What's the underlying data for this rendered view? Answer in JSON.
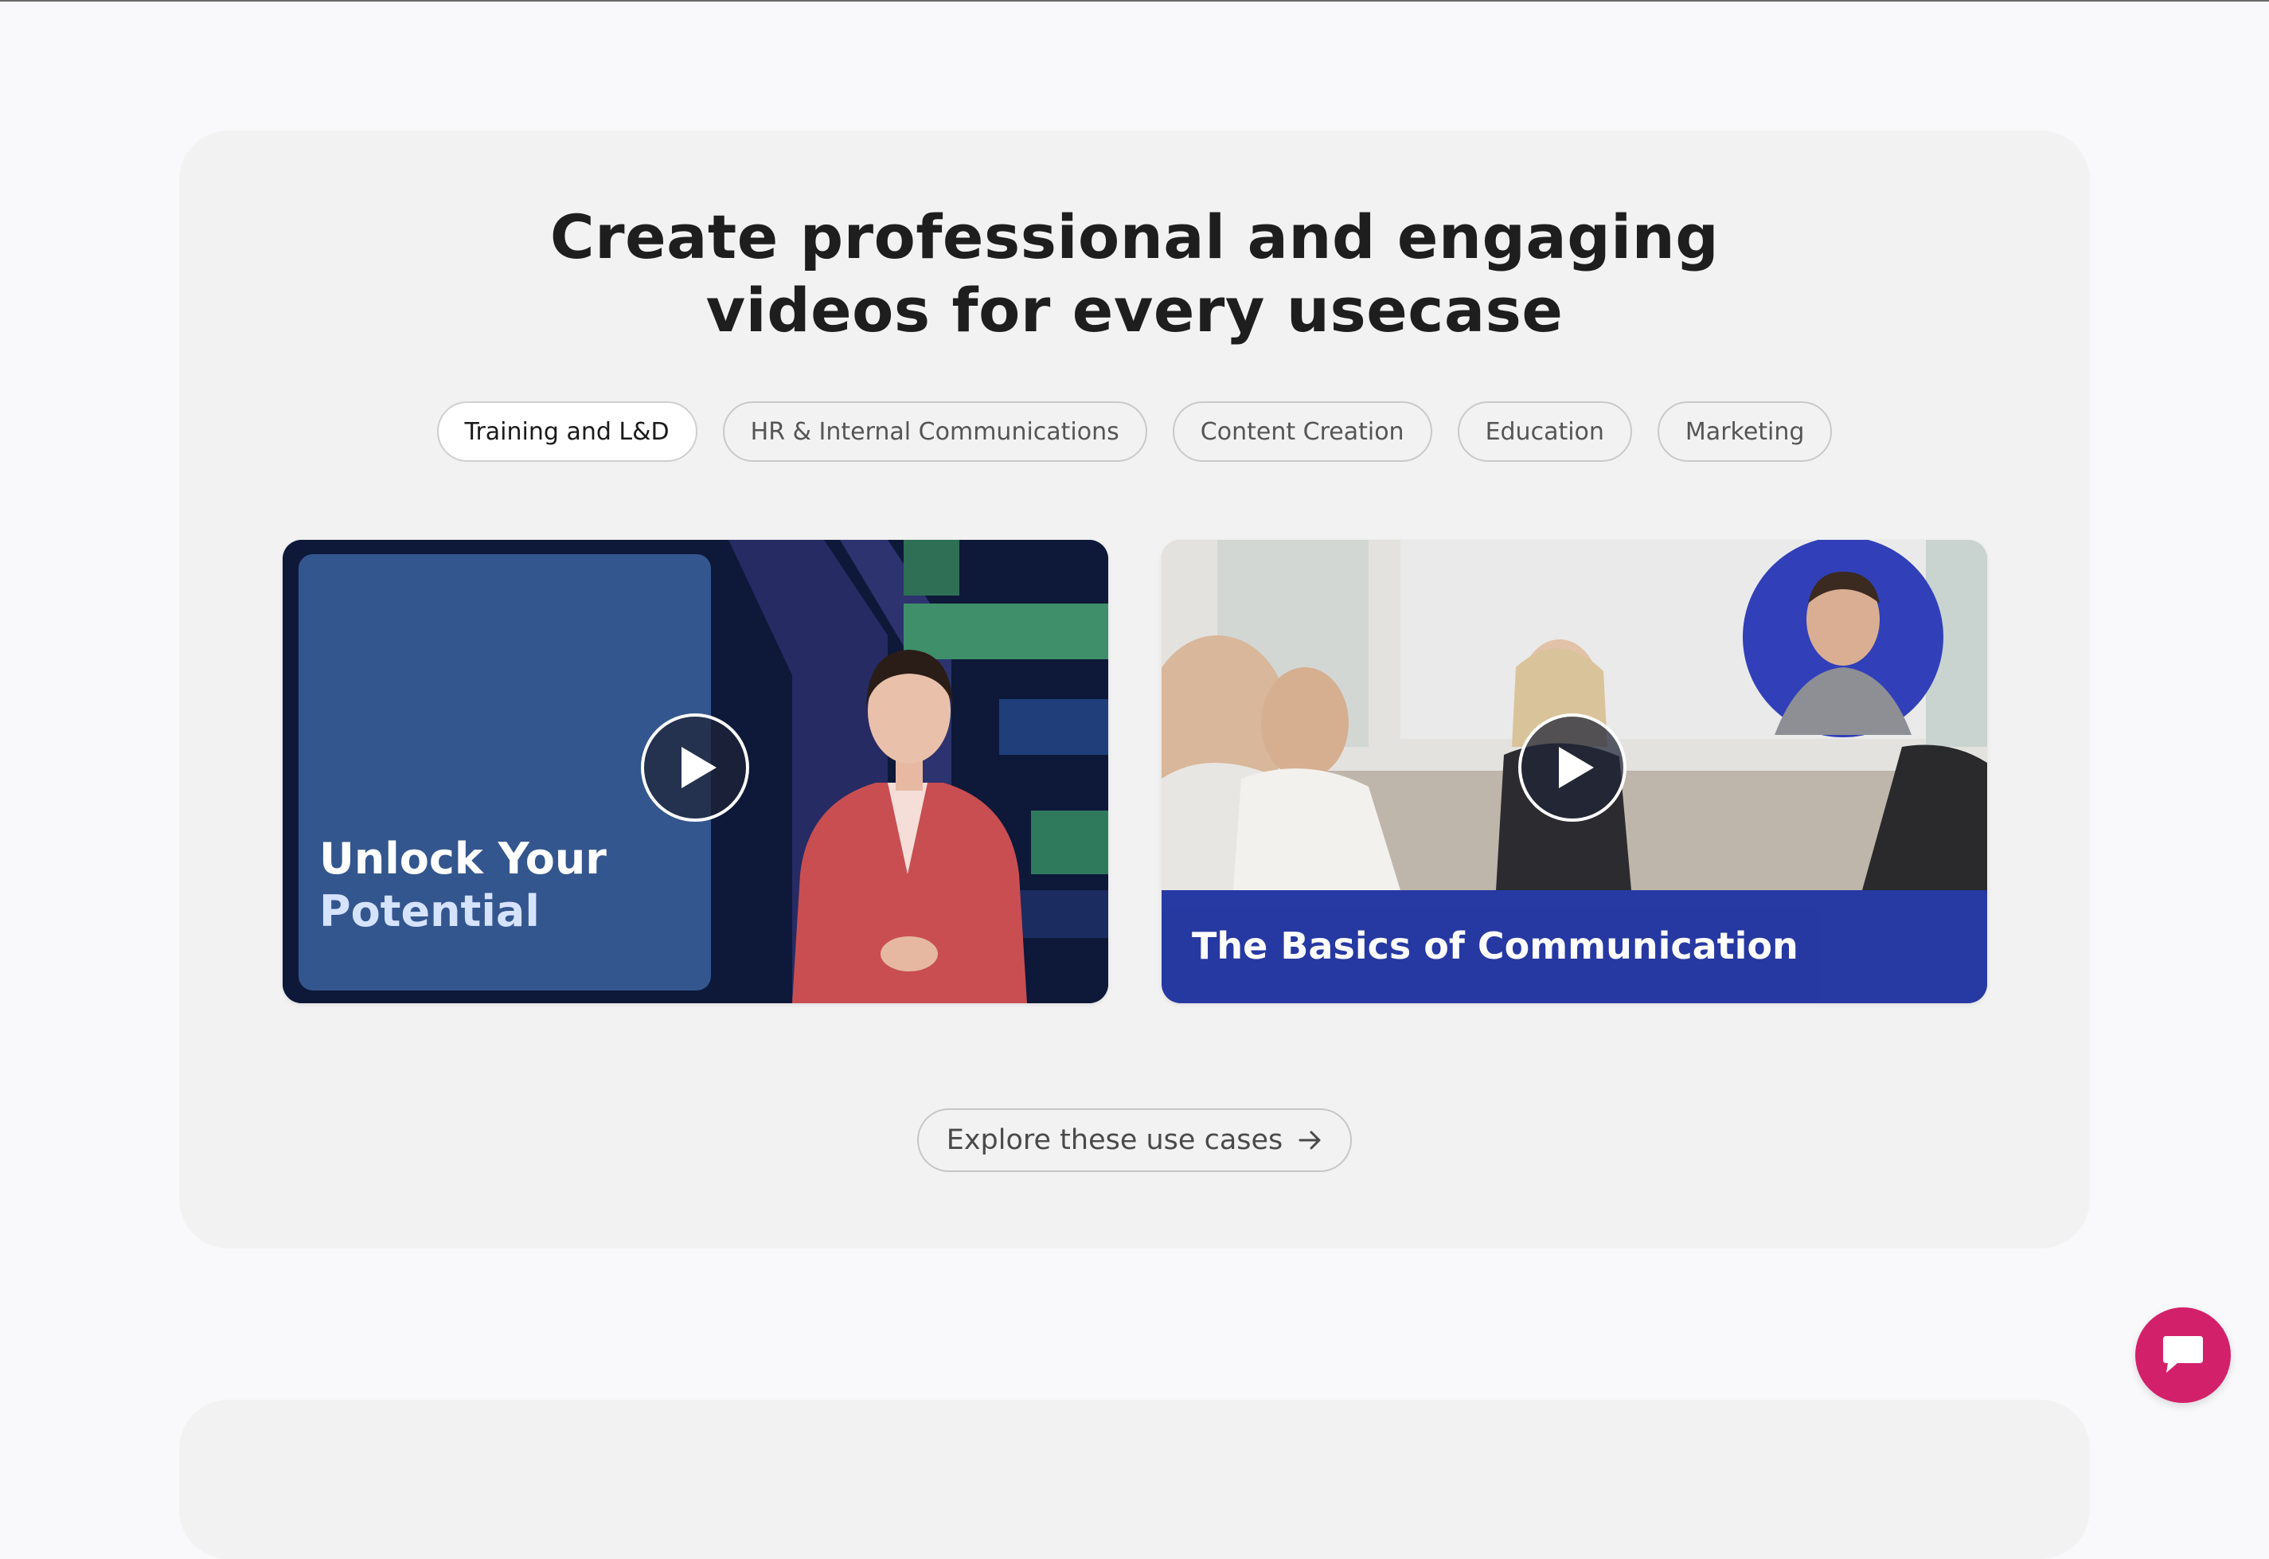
{
  "section": {
    "headline_line1": "Create professional and engaging",
    "headline_line2": "videos for every usecase"
  },
  "tabs": [
    {
      "label": "Training and L&D",
      "active": true
    },
    {
      "label": "HR & Internal Communications",
      "active": false
    },
    {
      "label": "Content Creation",
      "active": false
    },
    {
      "label": "Education",
      "active": false
    },
    {
      "label": "Marketing",
      "active": false
    }
  ],
  "videos": [
    {
      "title_line1": "Unlock Your",
      "title_line2": "Potential",
      "icon": "play-icon"
    },
    {
      "title": "The Basics of Communication",
      "icon": "play-icon"
    }
  ],
  "explore": {
    "label": "Explore these use cases",
    "icon": "arrow-right-icon"
  },
  "chat": {
    "icon": "chat-bubble-icon"
  },
  "colors": {
    "accent_chat": "#d3206a",
    "card1_box": "#34568e",
    "card2_caption": "#2033a0"
  }
}
